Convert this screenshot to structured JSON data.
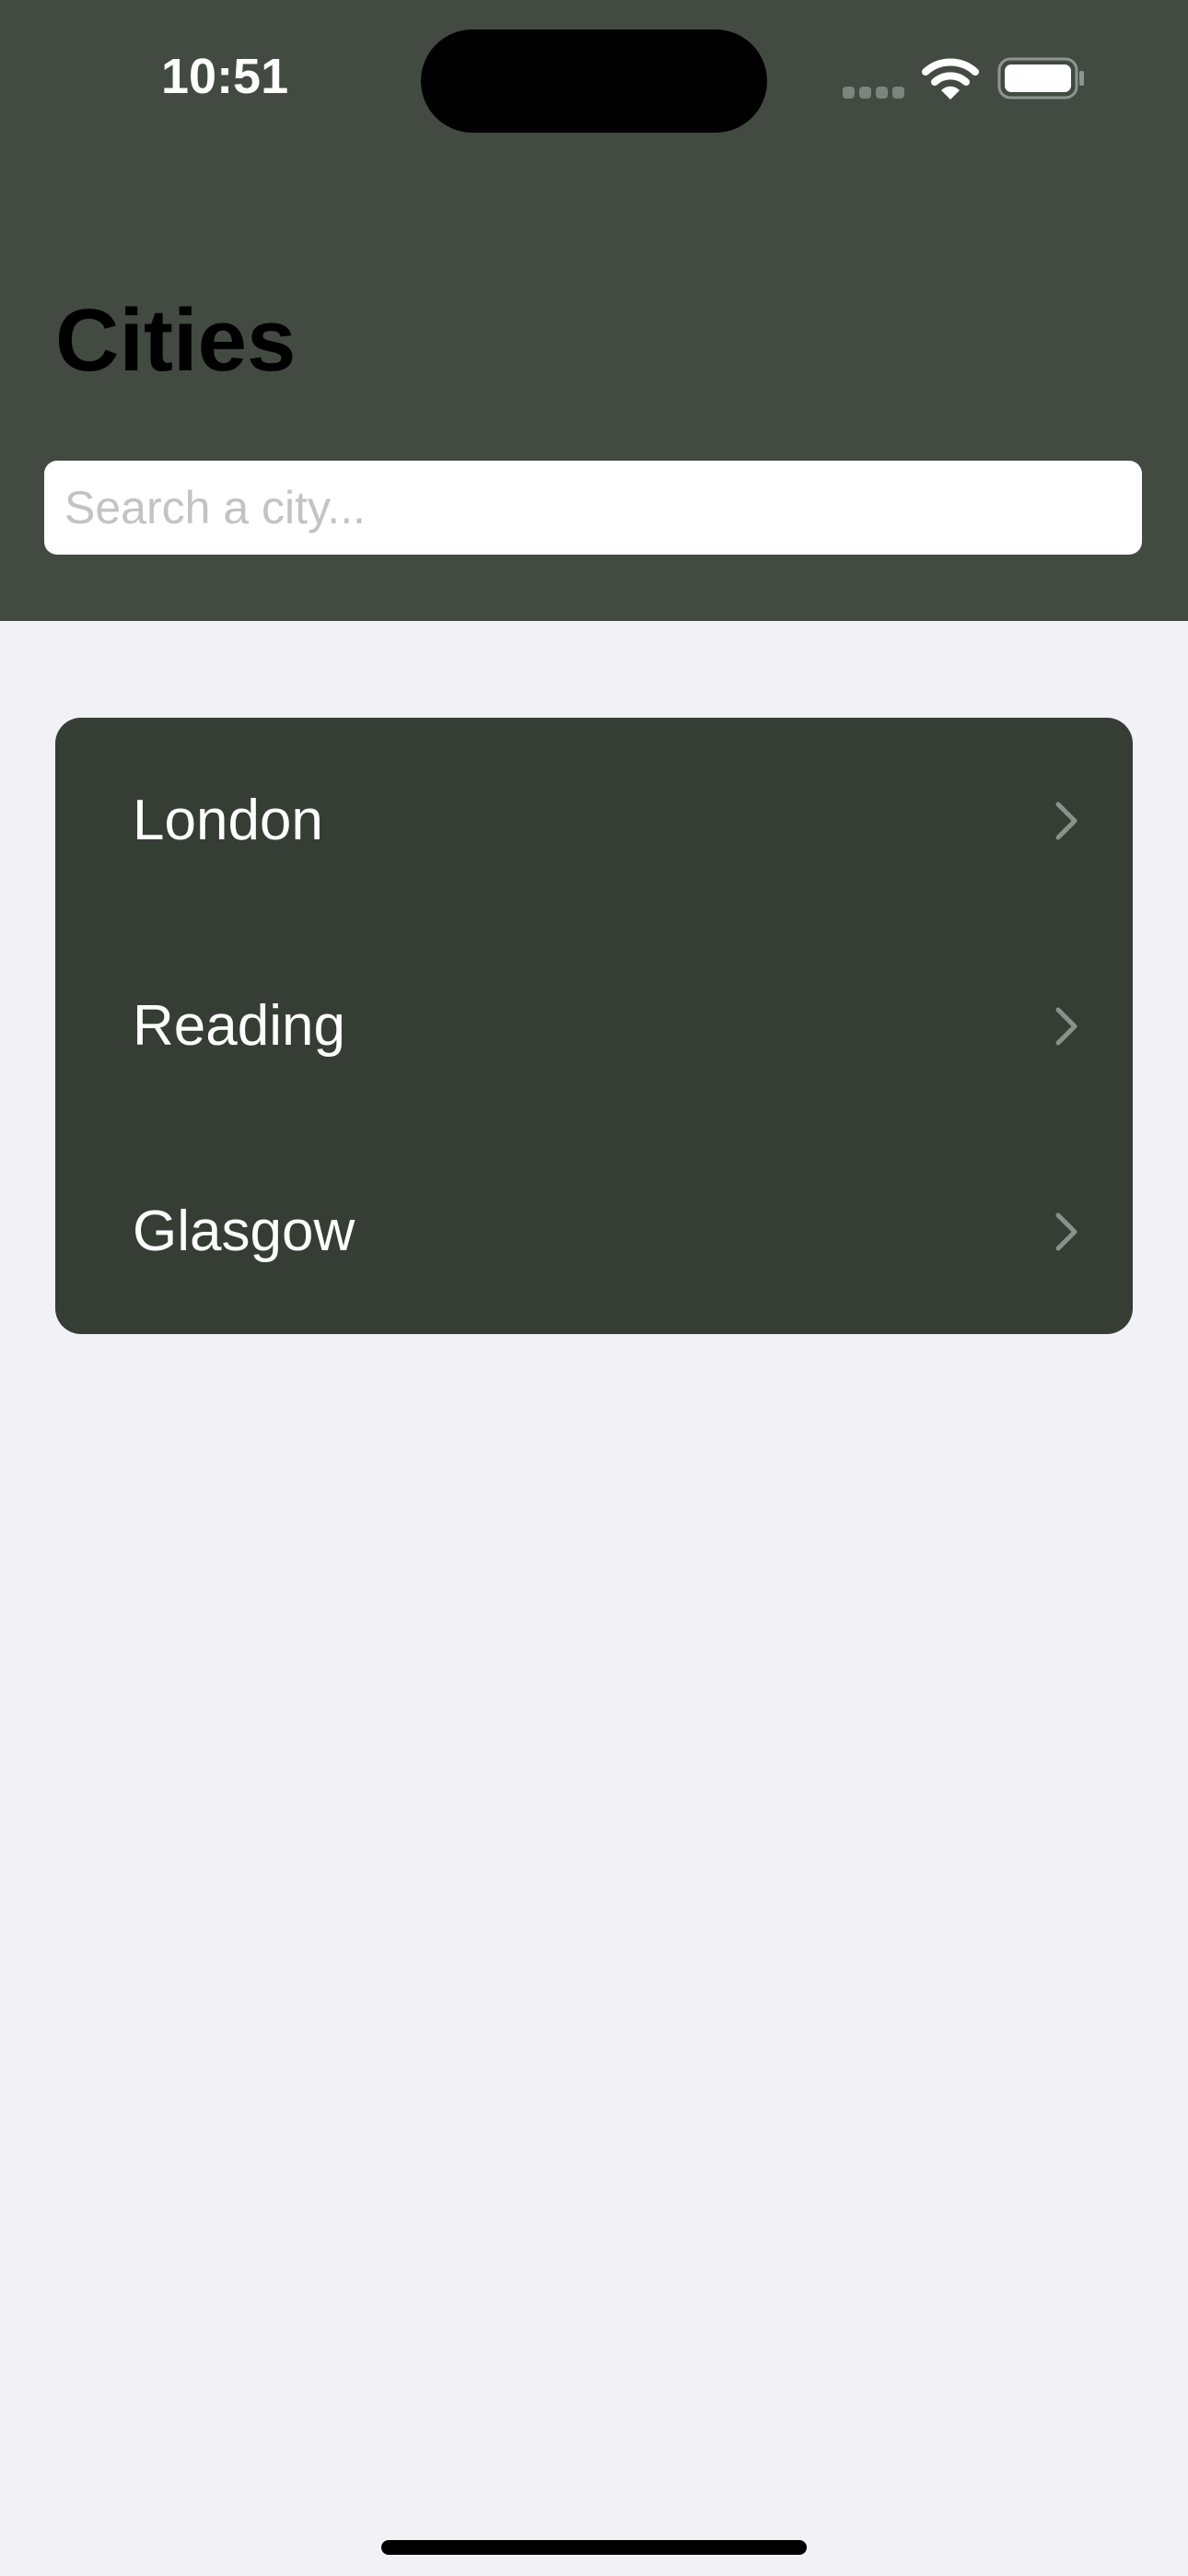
{
  "status_bar": {
    "time": "10:51",
    "icons": [
      "cellular-signal-icon",
      "wifi-icon",
      "battery-icon"
    ]
  },
  "header": {
    "title": "Cities"
  },
  "search": {
    "placeholder": "Search a city...",
    "value": ""
  },
  "cities": [
    {
      "label": "London",
      "icon": "chevron-right-icon"
    },
    {
      "label": "Reading",
      "icon": "chevron-right-icon"
    },
    {
      "label": "Glasgow",
      "icon": "chevron-right-icon"
    }
  ],
  "colors": {
    "header_bg": "#424a42",
    "list_bg": "#353d35",
    "page_bg": "#f1f1f6",
    "row_text": "#ffffff",
    "chevron": "#8a918a"
  }
}
